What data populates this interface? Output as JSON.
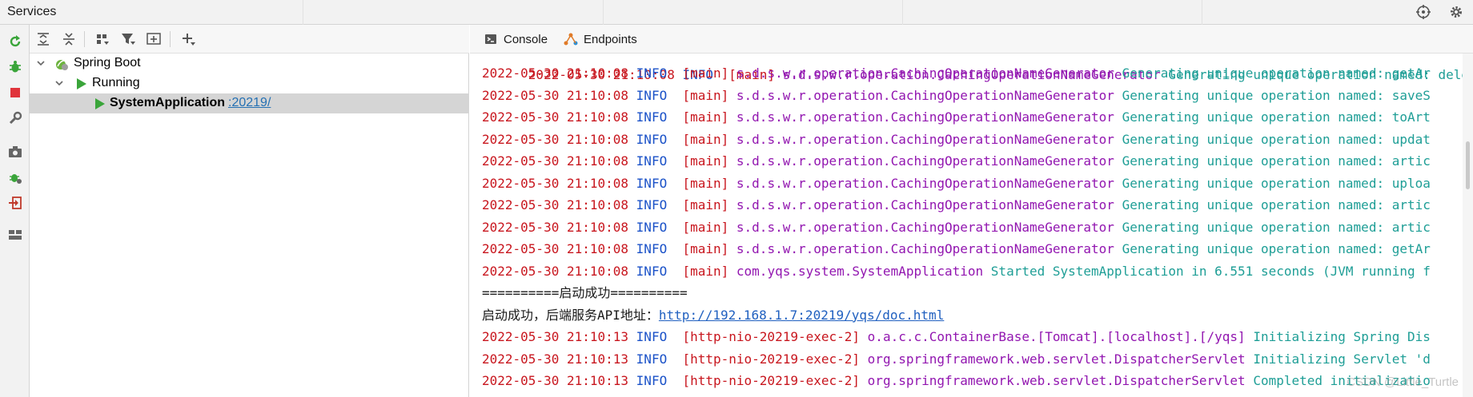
{
  "window": {
    "title": "Services"
  },
  "titlebar_icons": [
    "crosshair-icon",
    "gear-icon"
  ],
  "leftstrip_icons": [
    "rerun-icon",
    "debug-icon",
    "stop-icon",
    "wrench-icon",
    "camera-icon",
    "debug-settings-icon",
    "login-icon",
    "layout-icon"
  ],
  "tree_toolbar_icons": [
    "expand-all-icon",
    "collapse-all-icon",
    "group-icon",
    "filter-icon",
    "new-service-icon",
    "add-icon"
  ],
  "tree": {
    "root_label": "Spring Boot",
    "group_label": "Running",
    "app_label": "SystemApplication",
    "app_port": ":20219/"
  },
  "tabs": {
    "console": "Console",
    "endpoints": "Endpoints"
  },
  "log": {
    "partial_top": "2022-05-30 21:10:08 INFO  [main] s.d.s.w.r.operation.CachingOperationNameGenerator Generating unique operation named: delet",
    "lines": [
      {
        "ts": "2022-05-30 21:10:08",
        "level": "INFO",
        "thread": "[main]",
        "logger": "s.d.s.w.r.operation.CachingOperationNameGenerator",
        "msg": "Generating unique operation named: getAr"
      },
      {
        "ts": "2022-05-30 21:10:08",
        "level": "INFO",
        "thread": "[main]",
        "logger": "s.d.s.w.r.operation.CachingOperationNameGenerator",
        "msg": "Generating unique operation named: saveS"
      },
      {
        "ts": "2022-05-30 21:10:08",
        "level": "INFO",
        "thread": "[main]",
        "logger": "s.d.s.w.r.operation.CachingOperationNameGenerator",
        "msg": "Generating unique operation named: toArt"
      },
      {
        "ts": "2022-05-30 21:10:08",
        "level": "INFO",
        "thread": "[main]",
        "logger": "s.d.s.w.r.operation.CachingOperationNameGenerator",
        "msg": "Generating unique operation named: updat"
      },
      {
        "ts": "2022-05-30 21:10:08",
        "level": "INFO",
        "thread": "[main]",
        "logger": "s.d.s.w.r.operation.CachingOperationNameGenerator",
        "msg": "Generating unique operation named: artic"
      },
      {
        "ts": "2022-05-30 21:10:08",
        "level": "INFO",
        "thread": "[main]",
        "logger": "s.d.s.w.r.operation.CachingOperationNameGenerator",
        "msg": "Generating unique operation named: uploa"
      },
      {
        "ts": "2022-05-30 21:10:08",
        "level": "INFO",
        "thread": "[main]",
        "logger": "s.d.s.w.r.operation.CachingOperationNameGenerator",
        "msg": "Generating unique operation named: artic"
      },
      {
        "ts": "2022-05-30 21:10:08",
        "level": "INFO",
        "thread": "[main]",
        "logger": "s.d.s.w.r.operation.CachingOperationNameGenerator",
        "msg": "Generating unique operation named: artic"
      },
      {
        "ts": "2022-05-30 21:10:08",
        "level": "INFO",
        "thread": "[main]",
        "logger": "s.d.s.w.r.operation.CachingOperationNameGenerator",
        "msg": "Generating unique operation named: getAr"
      },
      {
        "ts": "2022-05-30 21:10:08",
        "level": "INFO",
        "thread": "[main]",
        "logger": "com.yqs.system.SystemApplication",
        "msg": "Started SystemApplication in 6.551 seconds (JVM running f"
      }
    ],
    "banner": "==========启动成功==========",
    "api_prefix": "启动成功，后端服务API地址：",
    "api_url": "http://192.168.1.7:20219/yqs/doc.html",
    "lines2": [
      {
        "ts": "2022-05-30 21:10:13",
        "level": "INFO",
        "thread": "[http-nio-20219-exec-2]",
        "logger": "o.a.c.c.ContainerBase.[Tomcat].[localhost].[/yqs]",
        "msg": "Initializing Spring Dis"
      },
      {
        "ts": "2022-05-30 21:10:13",
        "level": "INFO",
        "thread": "[http-nio-20219-exec-2]",
        "logger": "org.springframework.web.servlet.DispatcherServlet",
        "msg": "Initializing Servlet 'd"
      },
      {
        "ts": "2022-05-30 21:10:13",
        "level": "INFO",
        "thread": "[http-nio-20219-exec-2]",
        "logger": "org.springframework.web.servlet.DispatcherServlet",
        "msg": "Completed initializatio"
      }
    ]
  },
  "watermark": "CSDN @Little_Turtle",
  "colors": {
    "timestamp": "#c8161e",
    "level": "#1b52c8",
    "logger": "#9216b0",
    "message": "#1e9e96",
    "run": "#3aa53a"
  }
}
